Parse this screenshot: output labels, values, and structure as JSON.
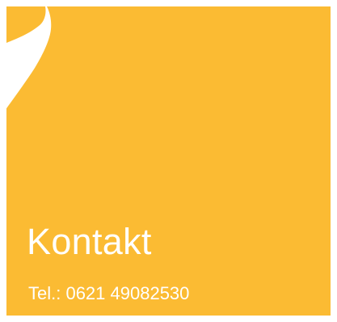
{
  "card": {
    "title": "Kontakt",
    "phone": "Tel.: 0621 49082530",
    "background_color": "#fbbb33",
    "text_color": "#ffffff",
    "decoration": "white-swoosh-shape"
  }
}
